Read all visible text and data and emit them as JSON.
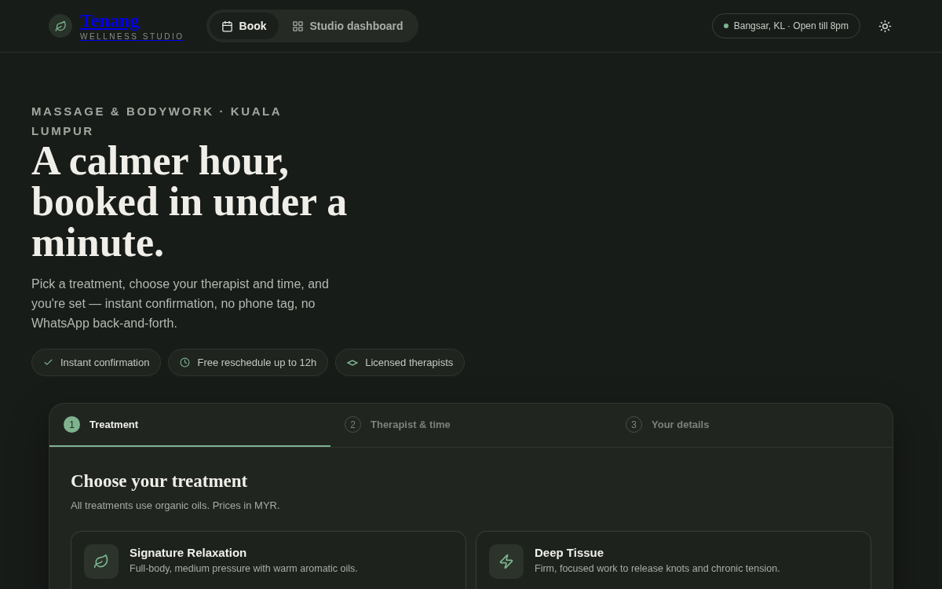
{
  "brand": {
    "name": "Tenang",
    "tagline": "WELLNESS STUDIO"
  },
  "nav": [
    {
      "label": "Book",
      "kind": "calendar",
      "selected": true
    },
    {
      "label": "Studio dashboard",
      "kind": "grid",
      "selected": false
    }
  ],
  "status": {
    "text": "Bangsar, KL · Open till 8pm",
    "open": true
  },
  "hero": {
    "eyebrow": "MASSAGE & BODYWORK · KUALA LUMPUR",
    "title": "A calmer hour, booked in under a minute.",
    "lead": "Pick a treatment, choose your therapist and time, and you're set — instant confirmation, no phone tag, no WhatsApp back-and-forth.",
    "chips": [
      {
        "label": "Instant confirmation",
        "kind": "check"
      },
      {
        "label": "Free reschedule up to 12h",
        "kind": "clock"
      },
      {
        "label": "Licensed therapists",
        "kind": "diamond"
      }
    ]
  },
  "steps": [
    {
      "number": "1",
      "label": "Treatment",
      "selected": true
    },
    {
      "number": "2",
      "label": "Therapist & time",
      "selected": false
    },
    {
      "number": "3",
      "label": "Your details",
      "selected": false
    }
  ],
  "section": {
    "title": "Choose your treatment",
    "subtitle": "All treatments use organic oils. Prices in MYR."
  },
  "treatments": [
    {
      "name": "Signature Relaxation",
      "description": "Full-body, medium pressure with warm aromatic oils.",
      "kind": "leaf"
    },
    {
      "name": "Deep Tissue",
      "description": "Firm, focused work to release knots and chronic tension.",
      "kind": "zap"
    }
  ]
}
